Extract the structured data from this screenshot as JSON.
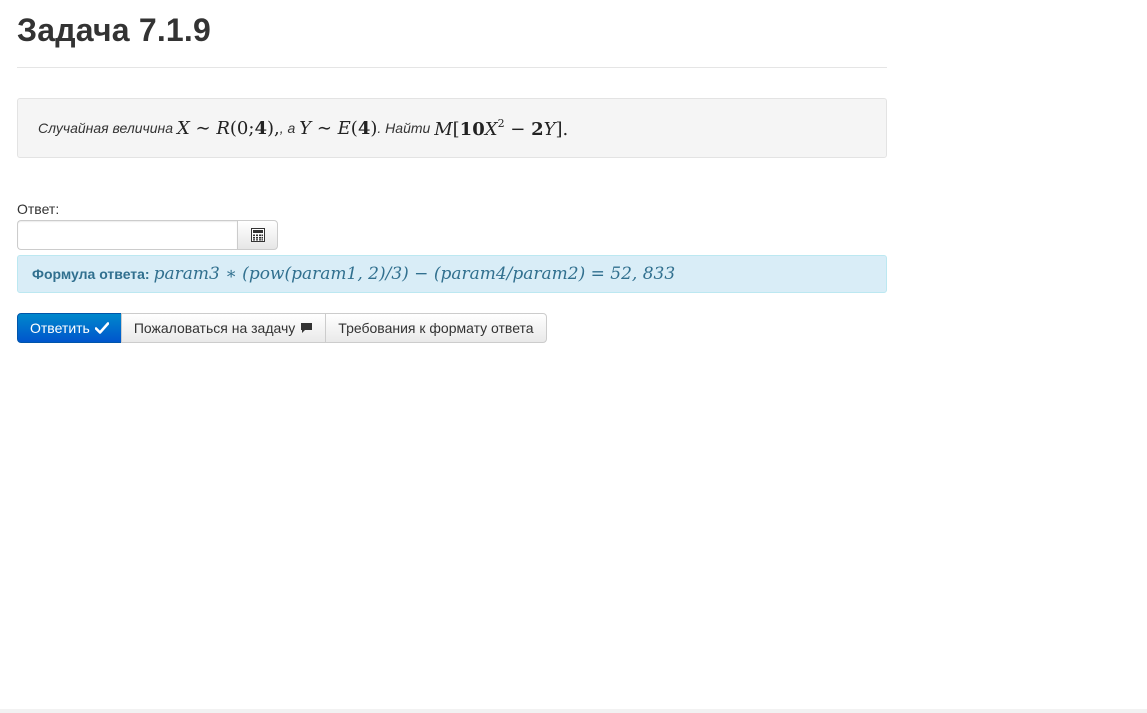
{
  "page": {
    "title": "Задача 7.1.9"
  },
  "task": {
    "text_1": "Случайная величина",
    "text_2": ", а",
    "text_3": ". Найти",
    "math": {
      "x": "X",
      "sim": "∼",
      "r": "R",
      "r_args": "(0;",
      "r_b": "4",
      "r_close": "),",
      "y": "Y",
      "e": "E",
      "e_args": "(",
      "e_b": "4",
      "e_close": ")",
      "m": "M",
      "m_open": "[",
      "m_coef": "10",
      "m_x": "X",
      "m_pow": "2",
      "m_minus": " − ",
      "m_coef2": "2",
      "m_y": "Y",
      "m_close": "]."
    }
  },
  "answer": {
    "label": "Ответ:",
    "value": "",
    "placeholder": "",
    "calculator_icon": "calculator-icon"
  },
  "formula": {
    "label": "Формула ответа:",
    "expression": "param3 ∗ (pow(param1, 2)/3) − (param4/param2) = 52, 833"
  },
  "buttons": {
    "submit": "Ответить",
    "submit_icon": "checkmark-icon",
    "report": "Пожаловаться на задачу",
    "report_icon": "comment-icon",
    "requirements": "Требования к формату ответа"
  },
  "colors": {
    "primary": "#0066cc",
    "info_bg": "#d9edf7",
    "info_text": "#31708f",
    "well_bg": "#f5f5f5"
  }
}
